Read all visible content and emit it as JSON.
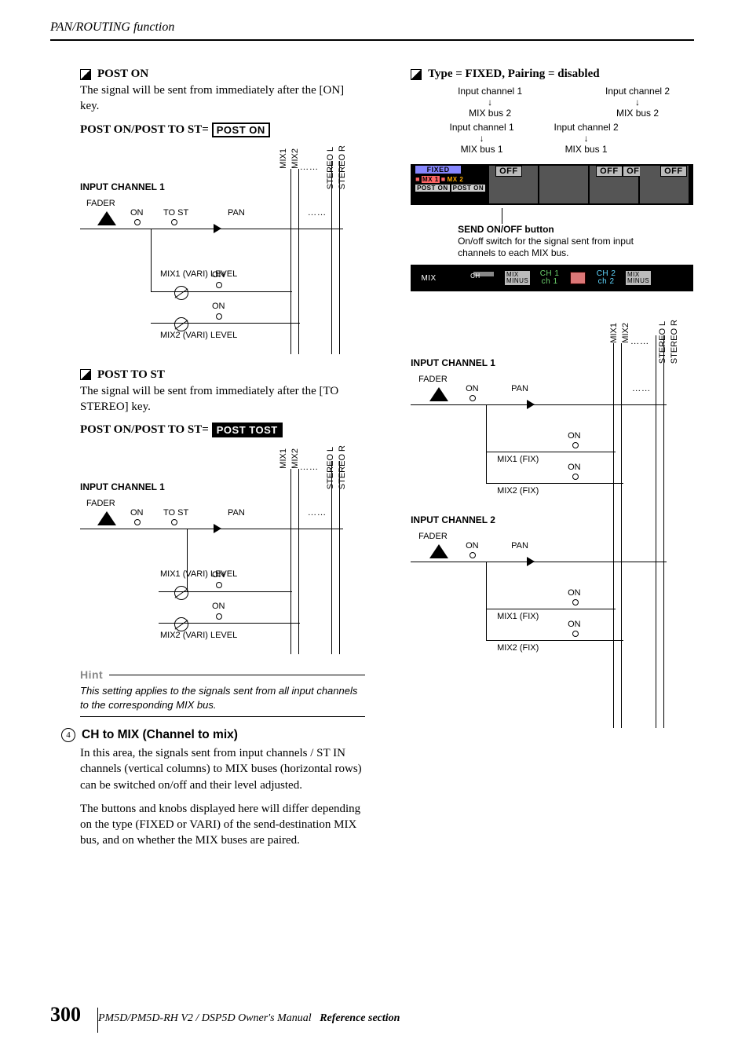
{
  "header": "PAN/ROUTING function",
  "page_number": "300",
  "footer_a": "PM5D/PM5D-RH V2 / DSP5D Owner's Manual",
  "footer_b": "Reference section",
  "post_on": {
    "title": "POST ON",
    "body": "The signal will be sent from immediately after the [ON] key.",
    "param": "POST ON/POST TO ST=",
    "value": "POST  ON",
    "diagram": {
      "title": "INPUT CHANNEL 1",
      "fader": "FADER",
      "on": "ON",
      "to_st": "TO ST",
      "pan": "PAN",
      "mix1": "MIX1 (VARI) LEVEL",
      "mix2": "MIX2 (VARI) LEVEL",
      "bus_m1": "MIX1",
      "bus_m2": "MIX2",
      "bus_sl": "STEREO L",
      "bus_sr": "STEREO R",
      "ellipsis": "……"
    }
  },
  "post_to_st": {
    "title": "POST TO ST",
    "body": "The signal will be sent from immediately after the [TO STEREO] key.",
    "param": "POST ON/POST TO ST=",
    "value": "POST TOST"
  },
  "hint": {
    "label": "Hint",
    "text": "This setting applies to the signals sent from all input channels to the corresponding MIX bus."
  },
  "item4": {
    "num": "4",
    "title": "CH to MIX (Channel to mix)",
    "p1": "In this area, the signals sent from input channels / ST IN channels (vertical columns) to MIX buses (horizontal rows) can be switched on/off and their level adjusted.",
    "p2": "The buttons and knobs displayed here will differ depending on the type (FIXED or VARI) of the send-destination MIX bus, and on whether the MIX buses are paired."
  },
  "right": {
    "title": "Type = FIXED, Pairing = disabled",
    "ch1": "Input channel 1",
    "ch2": "Input channel 2",
    "mb1": "MIX bus 1",
    "mb2": "MIX bus 2",
    "fixed": "FIXED",
    "mx1": "MX 1",
    "mx2": "MX 2",
    "post_on": "POST ON",
    "off": "OFF",
    "caption_title": "SEND ON/OFF button",
    "caption_body": "On/off switch for the signal sent from input channels to each MIX bus.",
    "mm": {
      "mix": "MIX",
      "ch": "CH",
      "mm_a": "MIX",
      "mm_b": "MINUS",
      "ch1a": "CH 1",
      "ch1b": "ch 1",
      "ch2a": "CH 2",
      "ch2b": "ch 2"
    },
    "sig2": {
      "ic1": "INPUT CHANNEL 1",
      "ic2": "INPUT CHANNEL 2",
      "fader": "FADER",
      "on": "ON",
      "pan": "PAN",
      "mix1fix": "MIX1 (FIX)",
      "mix2fix": "MIX2 (FIX)",
      "bus_m1": "MIX1",
      "bus_m2": "MIX2",
      "bus_sl": "STEREO L",
      "bus_sr": "STEREO R",
      "ellipsis": "……"
    }
  }
}
